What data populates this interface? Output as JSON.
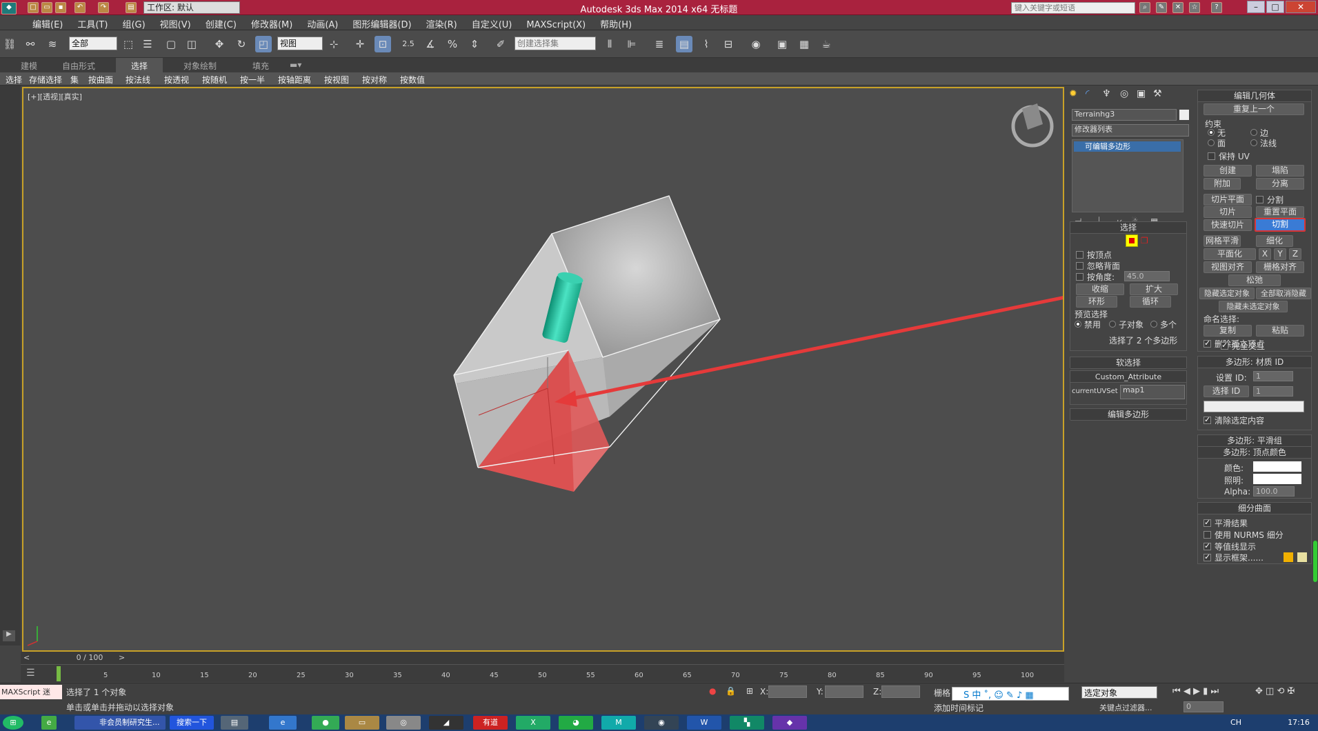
{
  "window": {
    "title": "Autodesk 3ds Max  2014 x64       无标题",
    "workspace": "工作区: 默认",
    "search_placeholder": "键入关键字或短语"
  },
  "menu": [
    "编辑(E)",
    "工具(T)",
    "组(G)",
    "视图(V)",
    "创建(C)",
    "修改器(M)",
    "动画(A)",
    "图形编辑器(D)",
    "渲染(R)",
    "自定义(U)",
    "MAXScript(X)",
    "帮助(H)"
  ],
  "toolbar": {
    "selection_filter": "全部",
    "ref_coord": "视图",
    "snap_label": "2.5",
    "named_sel": "创建选择集"
  },
  "ribbon_tabs": [
    "建模",
    "自由形式",
    "选择",
    "对象绘制",
    "填充"
  ],
  "ribbon_items": [
    "选择",
    "存储选择",
    "集",
    "按曲面",
    "按法线",
    "按透视",
    "按随机",
    "按一半",
    "按轴距离",
    "按视图",
    "按对称",
    "按数值"
  ],
  "viewport": {
    "label": "[+][透视][真实]"
  },
  "panel": {
    "object_name": "Terrainhg3",
    "modifier_list": "修改器列表",
    "stack_item": "可编辑多边形",
    "selection": {
      "title": "选择",
      "by_vertex": "按顶点",
      "ignore_backfacing": "忽略背面",
      "by_angle": "按角度:",
      "angle_value": "45.0",
      "shrink": "收缩",
      "grow": "扩大",
      "ring": "环形",
      "loop": "循环",
      "preview": "预览选择",
      "preview_off": "禁用",
      "preview_sub": "子对象",
      "preview_multi": "多个",
      "status": "选择了 2 个多边形"
    },
    "soft_selection": "软选择",
    "custom_attr": "Custom_Attribute",
    "current_uv_label": "currentUVSet",
    "current_uv_value": "map1",
    "edit_poly": "编辑多边形",
    "edit_geometry": {
      "title": "编辑几何体",
      "repeat": "重复上一个",
      "constraints": "约束",
      "none": "无",
      "edge": "边",
      "face": "面",
      "normal": "法线",
      "preserve_uv": "保持 UV",
      "create": "创建",
      "collapse": "塌陷",
      "attach": "附加",
      "detach": "分离",
      "slice_plane": "切片平面",
      "split": "分割",
      "slice": "切片",
      "reset_plane": "重置平面",
      "quick_slice": "快速切片",
      "cut": "切割",
      "meshsmooth": "网格平滑",
      "tessellate": "细化",
      "make_planar": "平面化",
      "x": "X",
      "y": "Y",
      "z": "Z",
      "view_align": "视图对齐",
      "grid_align": "栅格对齐",
      "relax": "松弛",
      "hide_selected": "隐藏选定对象",
      "unhide_all": "全部取消隐藏",
      "hide_unselected": "隐藏未选定对象",
      "named_sel": "命名选择:",
      "copy": "复制",
      "paste": "粘贴",
      "delete_isolated": "删除孤立顶点",
      "full_interactivity": "完全交互"
    },
    "material_ids": {
      "title": "多边形: 材质 ID",
      "set_id": "设置 ID:",
      "set_id_value": "1",
      "select_id": "选择 ID",
      "select_id_value": "1",
      "clear_selection": "清除选定内容"
    },
    "smoothing_groups": "多边形: 平滑组",
    "vertex_colors": {
      "title": "多边形: 顶点颜色",
      "color": "颜色:",
      "illumination": "照明:",
      "alpha": "Alpha:",
      "alpha_value": "100.0"
    },
    "subdivision": {
      "title": "细分曲面",
      "smooth_result": "平滑结果",
      "use_nurms": "使用 NURMS 细分",
      "isoline": "等值线显示",
      "show_cage": "显示框架......"
    }
  },
  "timeline": {
    "frame": "0 / 100",
    "ticks": [
      "5",
      "10",
      "15",
      "20",
      "25",
      "30",
      "35",
      "40",
      "45",
      "50",
      "55",
      "60",
      "65",
      "70",
      "75",
      "80",
      "85",
      "90",
      "95",
      "100"
    ]
  },
  "status": {
    "line1": "选择了 1 个对象",
    "line2": "单击或单击并拖动以选择对象",
    "maxscript": "MAXScript 迷",
    "x_label": "X:",
    "y_label": "Y:",
    "z_label": "Z:",
    "grid": "栅格",
    "add_time_tag": "添加时间标记",
    "selected_object": "选定对象",
    "key_filters": "关键点过滤器...",
    "frame_input": "0"
  },
  "taskbar": {
    "items": [
      "非会员制研究生...",
      "搜索一下"
    ],
    "clock": "17:16",
    "lang": "CH"
  },
  "colors": {
    "title_bg": "#a9223e",
    "viewport_border": "#c9a227",
    "selected_poly": "#e05a5a",
    "cylinder": "#2ec8a8",
    "arrow": "#e53a3a",
    "cut_button": "#3a7bd5"
  }
}
